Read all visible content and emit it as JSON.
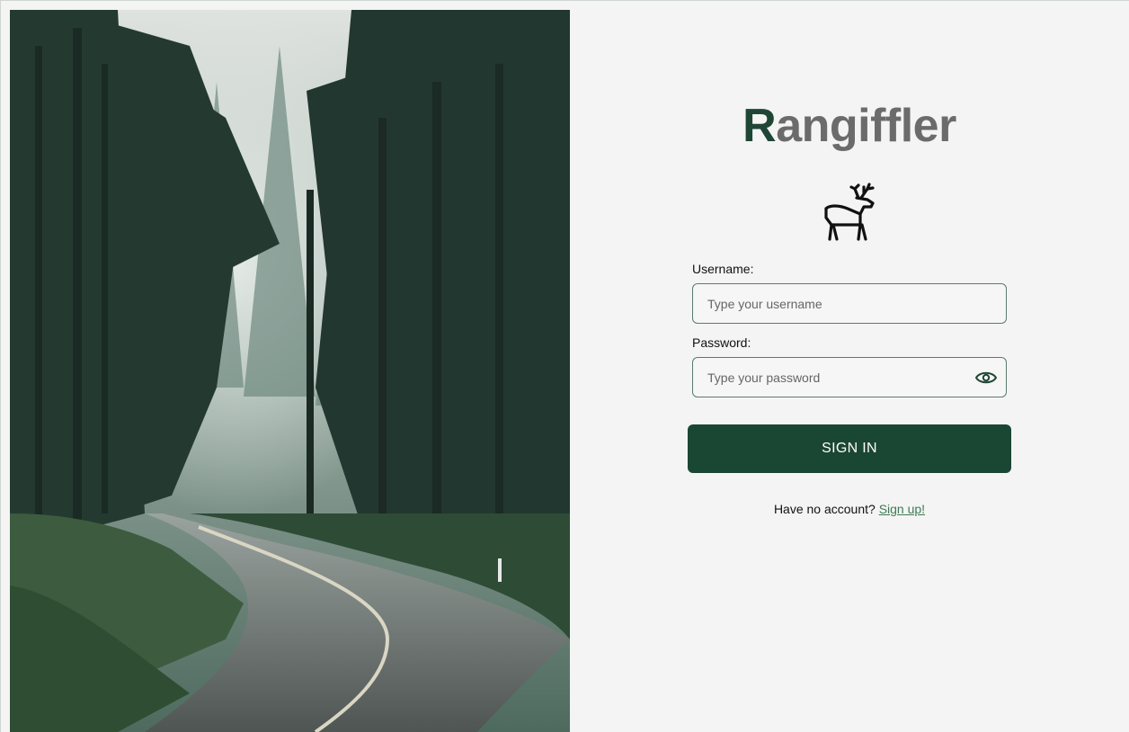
{
  "hero": {
    "image": "forest-road-photo"
  },
  "brand": {
    "first_letter": "R",
    "rest": "angiffler"
  },
  "logo": {
    "icon": "deer-icon"
  },
  "form": {
    "username_label": "Username:",
    "username_placeholder": "Type your username",
    "username_value": "",
    "password_label": "Password:",
    "password_placeholder": "Type your password",
    "password_value": "",
    "show_password_icon": "eye-icon",
    "submit_label": "SIGN IN"
  },
  "footer": {
    "prompt": "Have no account?",
    "link_label": "Sign up!"
  },
  "colors": {
    "accent": "#1a4634",
    "brand_grey": "#6b6b6b",
    "link": "#3f7a55",
    "background": "#f4f4f4"
  }
}
